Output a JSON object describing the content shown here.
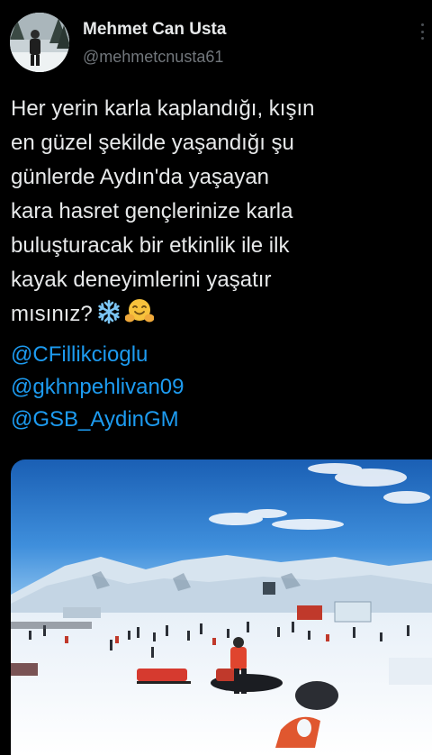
{
  "tweet": {
    "author_name": "Mehmet Can Usta",
    "author_handle": "@mehmetcnusta61",
    "text_lines": [
      "Her yerin karla kaplandığı, kışın",
      "en güzel şekilde yaşandığı şu",
      "günlerde Aydın'da yaşayan",
      "kara hasret gençlerinize karla",
      "buluşturacak bir etkinlik ile ilk",
      "kayak deneyimlerini yaşatır",
      "mısınız?"
    ],
    "emojis": [
      "snowflake-emoji",
      "hugging-face-emoji"
    ],
    "mentions": [
      "@CFillikcioglu",
      "@gkhnpehlivan09",
      "@GSB_AydinGM"
    ]
  },
  "icons": {
    "more": "more-options-icon"
  },
  "colors": {
    "background": "#000000",
    "text": "#e7e9ea",
    "secondary_text": "#71767b",
    "link": "#1d9bf0"
  }
}
